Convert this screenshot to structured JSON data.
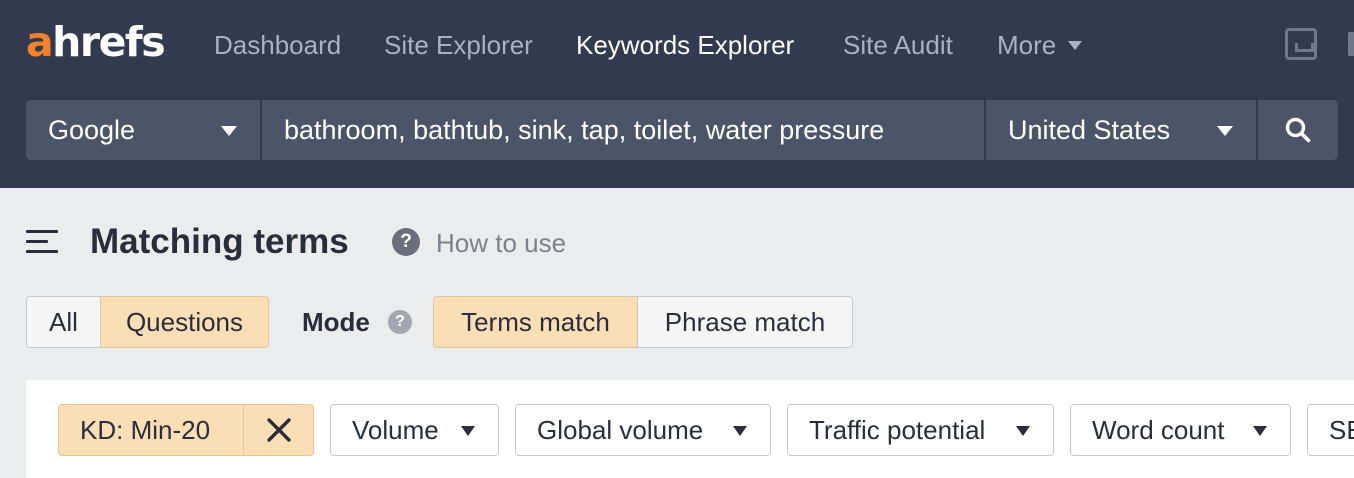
{
  "brand": {
    "logo_accent": "a",
    "logo_rest": "hrefs",
    "accent_color": "#f5822a"
  },
  "nav": {
    "items": [
      {
        "label": "Dashboard"
      },
      {
        "label": "Site Explorer"
      },
      {
        "label": "Keywords Explorer",
        "active": true
      },
      {
        "label": "Site Audit"
      },
      {
        "label": "More"
      }
    ],
    "icons": [
      "inbox-icon"
    ]
  },
  "search": {
    "engine": "Google",
    "query": "bathroom, bathtub, sink, tap, toilet, water pressure",
    "country": "United States",
    "button_icon": "search-icon"
  },
  "page": {
    "title": "Matching terms",
    "help_icon_glyph": "?",
    "how_to_use": "How to use"
  },
  "toggles": {
    "scope": [
      {
        "label": "All",
        "selected": false
      },
      {
        "label": "Questions",
        "selected": true
      }
    ],
    "mode_label": "Mode",
    "mode_help_glyph": "?",
    "mode": [
      {
        "label": "Terms match",
        "selected": true
      },
      {
        "label": "Phrase match",
        "selected": false
      }
    ]
  },
  "filters": {
    "active": {
      "label": "KD: Min-20",
      "clear_icon": "close-icon"
    },
    "dropdowns": [
      {
        "label": "Volume"
      },
      {
        "label": "Global volume"
      },
      {
        "label": "Traffic potential"
      },
      {
        "label": "Word count"
      },
      {
        "label": "SE"
      }
    ]
  },
  "colors": {
    "header_bg": "#323a50",
    "field_bg": "#4c5468",
    "selected_bg": "#fadeb5",
    "page_bg": "#ebecee"
  }
}
